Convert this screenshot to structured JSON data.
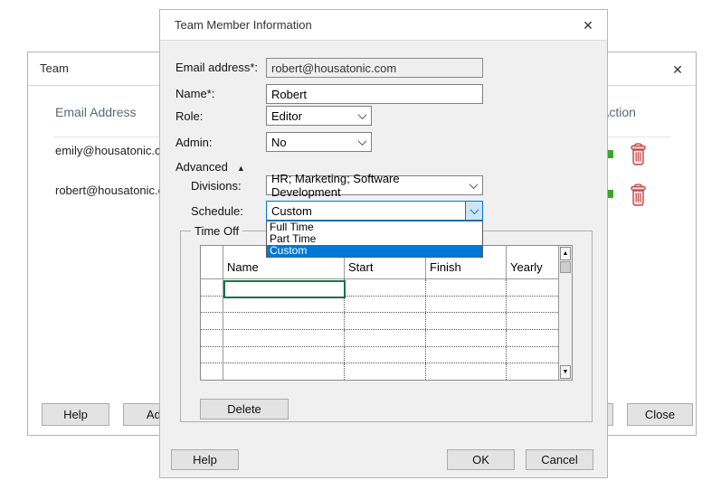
{
  "back_dialog": {
    "title": "Team",
    "close_icon": "✕",
    "columns": {
      "email": "Email Address",
      "action": "Action"
    },
    "rows": [
      {
        "email": "emily@housatonic.com"
      },
      {
        "email": "robert@housatonic.com"
      }
    ],
    "buttons": {
      "help": "Help",
      "add": "Add",
      "close": "Close"
    }
  },
  "dialog": {
    "title": "Team Member Information",
    "close_icon": "✕",
    "fields": {
      "email_label": "Email address*:",
      "email_value": "robert@housatonic.com",
      "name_label": "Name*:",
      "name_value": "Robert",
      "role_label": "Role:",
      "role_value": "Editor",
      "admin_label": "Admin:",
      "admin_value": "No",
      "advanced_label": "Advanced",
      "advanced_icon": "▲",
      "divisions_label": "Divisions:",
      "divisions_value": "HR; Marketing; Software Development",
      "schedule_label": "Schedule:",
      "schedule_value": "Custom"
    },
    "schedule_options": [
      "Full Time",
      "Part Time",
      "Custom"
    ],
    "schedule_selected": "Custom",
    "time_off": {
      "group_label": "Time Off",
      "columns": [
        "Name",
        "Start",
        "Finish",
        "Yearly"
      ],
      "empty_rows": 6,
      "delete_button": "Delete"
    },
    "scrollbar": {
      "up_icon": "▲",
      "down_icon": "▼"
    },
    "buttons": {
      "help": "Help",
      "ok": "OK",
      "cancel": "Cancel"
    }
  },
  "colors": {
    "accent_blue": "#0078d7",
    "selection_bg": "#0078d7",
    "focus_green": "#1e7245",
    "trash_red": "#c64848",
    "edit_green": "#39a426"
  }
}
